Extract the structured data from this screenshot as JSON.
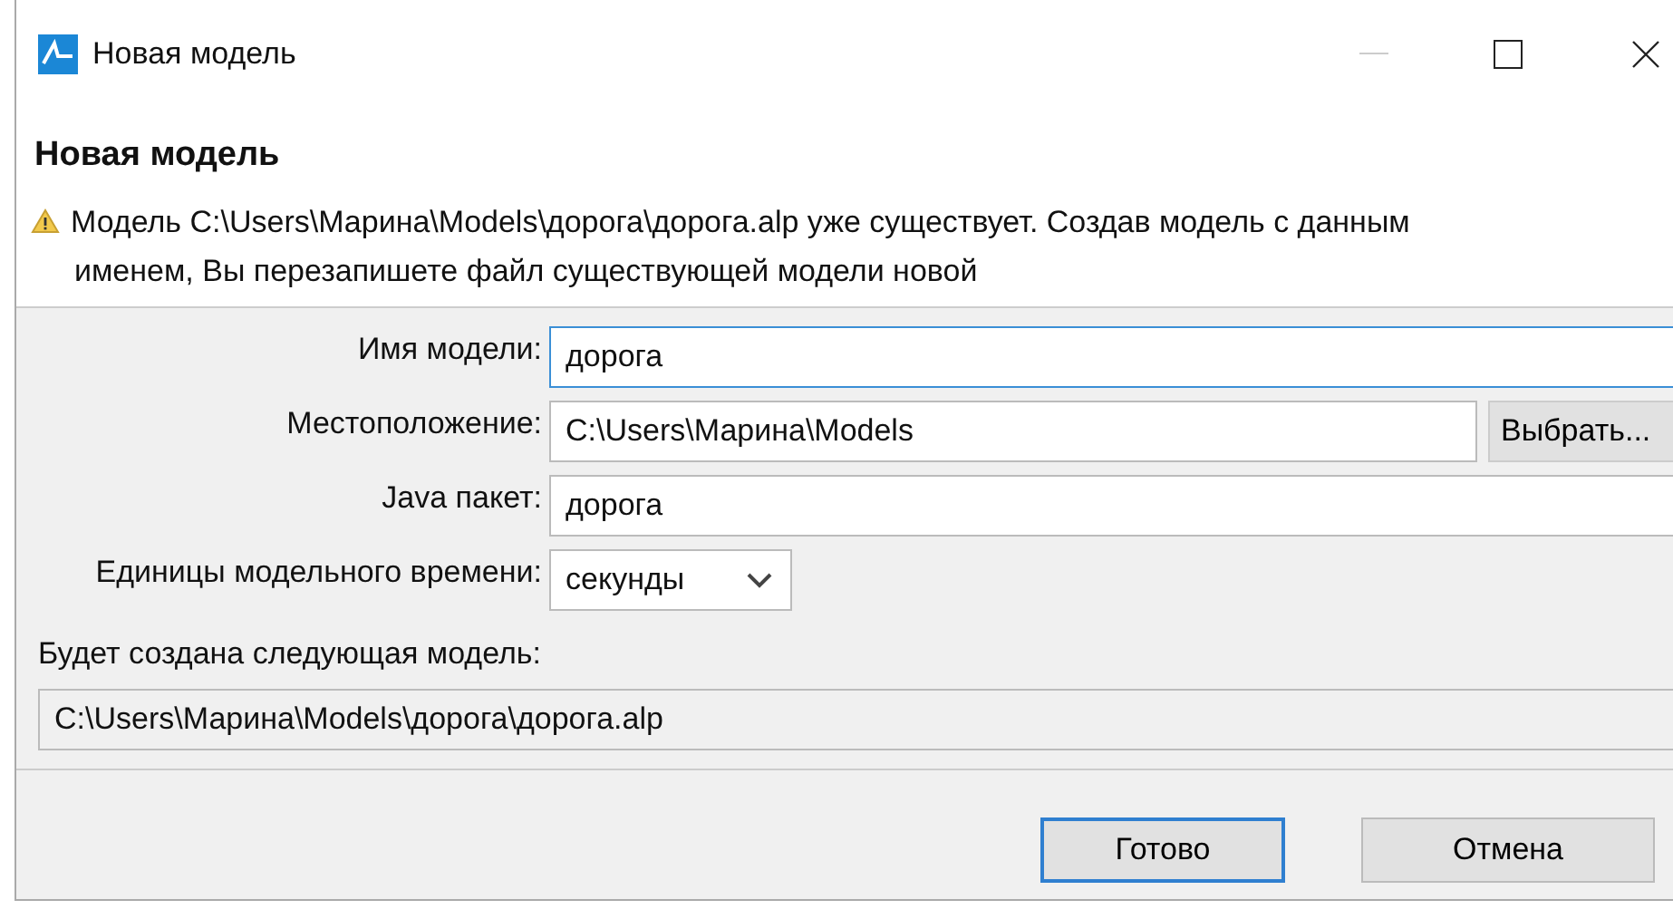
{
  "window": {
    "title": "Новая модель"
  },
  "header": {
    "title": "Новая модель",
    "warning": "Модель C:\\Users\\Марина\\Models\\дорога\\дорога.alp уже существует. Создав модель с данным именем, Вы перезапишете файл существующей модели новой"
  },
  "fields": [
    {
      "kind": "text",
      "label": "Имя модели:",
      "value": "дорога",
      "focused": true
    },
    {
      "kind": "browse",
      "label": "Местоположение:",
      "value": "C:\\Users\\Марина\\Models",
      "button": "Выбрать...",
      "focused": false
    },
    {
      "kind": "text",
      "label": "Java пакет:",
      "value": "дорога",
      "focused": false
    },
    {
      "kind": "combo",
      "label": "Единицы модельного времени:",
      "value": "секунды",
      "focused": false
    }
  ],
  "result": {
    "label": "Будет создана следующая модель:",
    "value": "C:\\Users\\Марина\\Models\\дорога\\дорога.alp"
  },
  "buttons": [
    {
      "label": "Готово",
      "default": true
    },
    {
      "label": "Отмена",
      "default": false
    }
  ]
}
